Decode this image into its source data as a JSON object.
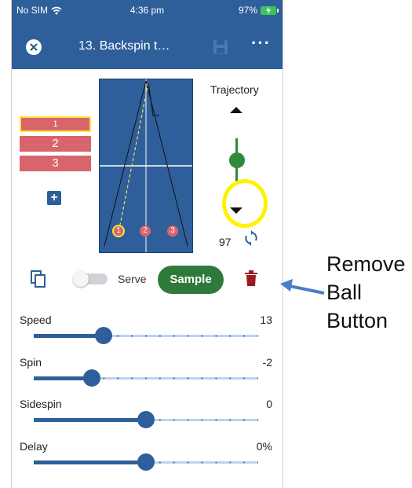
{
  "status_bar": {
    "carrier": "No SIM",
    "time": "4:36 pm",
    "battery": "97%"
  },
  "app_bar": {
    "title": "13. Backspin t…"
  },
  "balls": [
    {
      "label": "1",
      "selected": true
    },
    {
      "label": "2",
      "selected": false
    },
    {
      "label": "3",
      "selected": false
    }
  ],
  "table_markers": [
    "1",
    "2",
    "3"
  ],
  "trajectory": {
    "label": "Trajectory",
    "value": "97"
  },
  "actions": {
    "serve_label": "Serve",
    "sample_label": "Sample",
    "serve_on": false
  },
  "params": [
    {
      "label": "Speed",
      "value": "13",
      "level": 0.31
    },
    {
      "label": "Spin",
      "value": "-2",
      "level": 0.26
    },
    {
      "label": "Sidespin",
      "value": "0",
      "level": 0.5
    },
    {
      "label": "Delay",
      "value": "0%",
      "level": 0.5
    }
  ],
  "annotation": {
    "line1": "Remove",
    "line2": "Ball",
    "line3": "Button"
  },
  "colors": {
    "primary": "#2e5f9a",
    "ball": "#d9656c",
    "green": "#2f7a3b",
    "highlight": "#fff200",
    "trash": "#9c1b22"
  }
}
